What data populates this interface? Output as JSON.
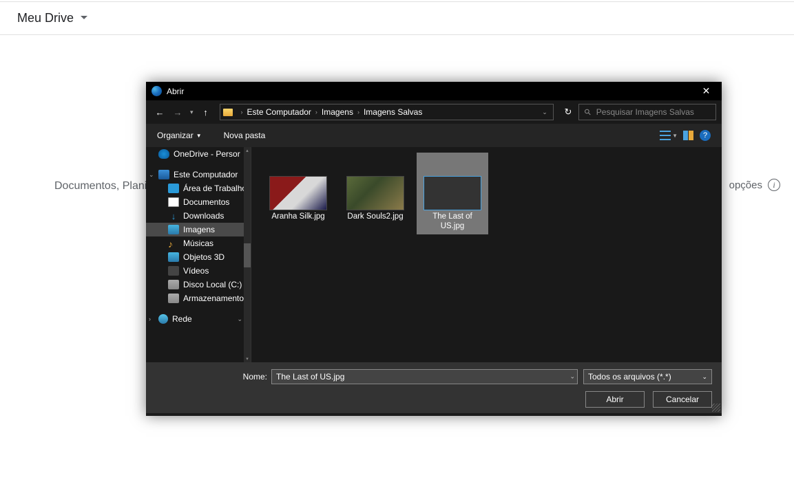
{
  "header": {
    "title": "Meu Drive"
  },
  "background": {
    "left_text": "Documentos, Plani",
    "right_text": "opções"
  },
  "dialog": {
    "title": "Abrir",
    "nav": {
      "breadcrumb": [
        "Este Computador",
        "Imagens",
        "Imagens Salvas"
      ],
      "search_placeholder": "Pesquisar Imagens Salvas"
    },
    "toolbar": {
      "organize": "Organizar",
      "new_folder": "Nova pasta"
    },
    "sidebar": {
      "onedrive": "OneDrive - Persor",
      "thispc": "Este Computador",
      "desktop": "Área de Trabalho",
      "documents": "Documentos",
      "downloads": "Downloads",
      "pictures": "Imagens",
      "music": "Músicas",
      "objects3d": "Objetos 3D",
      "videos": "Vídeos",
      "localdisk": "Disco Local (C:)",
      "storage": "Armazenamento",
      "network": "Rede"
    },
    "files": [
      {
        "name": "Aranha Silk.jpg"
      },
      {
        "name": "Dark Souls2.jpg"
      },
      {
        "name": "The Last of US.jpg",
        "selected": true
      }
    ],
    "footer": {
      "name_label": "Nome:",
      "name_value": "The Last of US.jpg",
      "filter": "Todos os arquivos (*.*)",
      "open": "Abrir",
      "cancel": "Cancelar"
    }
  }
}
